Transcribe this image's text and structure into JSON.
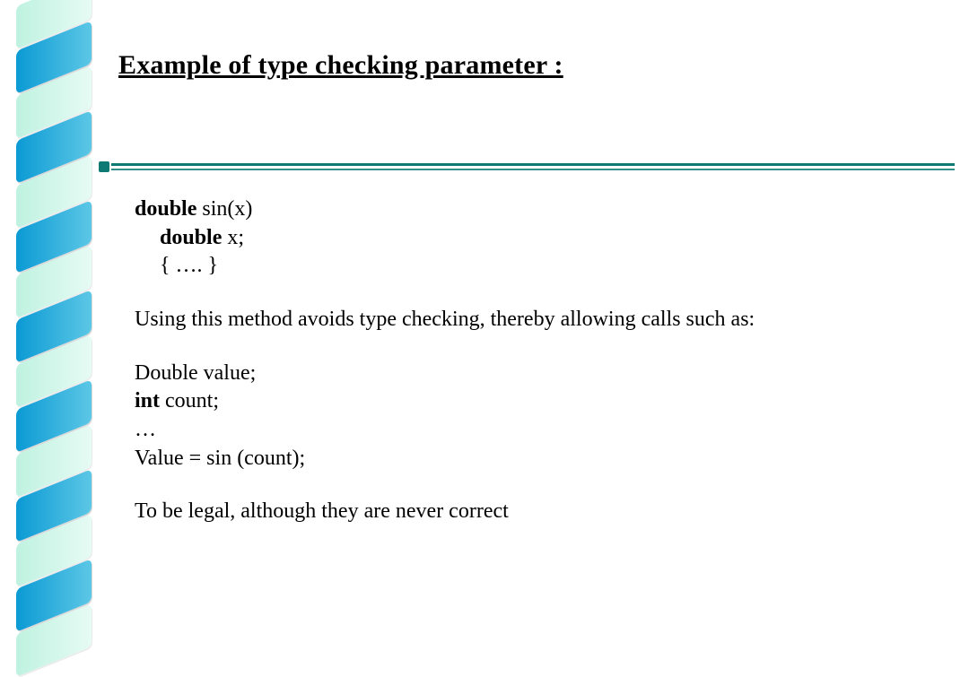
{
  "title": "Example of type checking parameter :",
  "code1": {
    "l1_bold": "double",
    "l1_rest": " sin(x)",
    "l2_bold": "double",
    "l2_rest": " x;",
    "l3": "{ …. }"
  },
  "para1": "Using this method avoids type checking, thereby allowing calls such as:",
  "code2": {
    "l1": "Double value;",
    "l2_bold": "int",
    "l2_rest": " count;",
    "l3": "…",
    "l4": "Value = sin (count);"
  },
  "para2": "To be legal, although they are never correct"
}
